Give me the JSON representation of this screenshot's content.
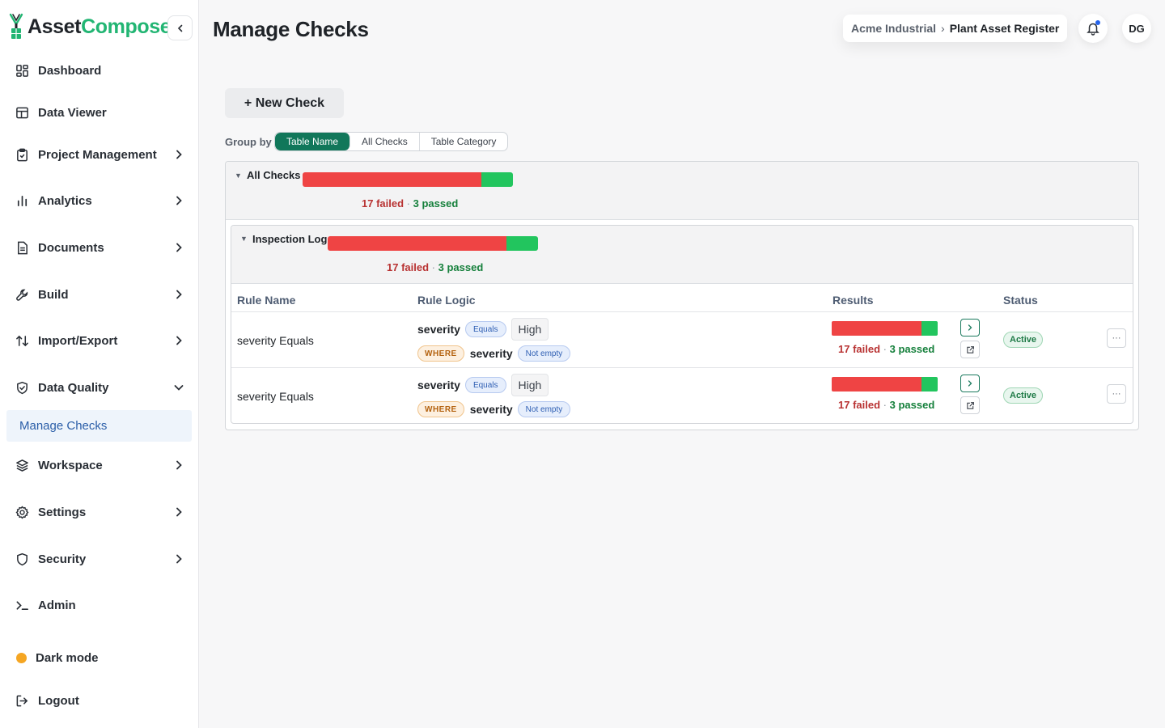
{
  "brand": {
    "part1": "Asset",
    "part2": "Compose"
  },
  "sidebar": {
    "items": [
      {
        "label": "Dashboard",
        "icon": "dashboard-icon"
      },
      {
        "label": "Data Viewer",
        "icon": "table-icon"
      },
      {
        "label": "Project Management",
        "icon": "clipboard-icon"
      },
      {
        "label": "Analytics",
        "icon": "bar-chart-icon"
      },
      {
        "label": "Documents",
        "icon": "document-icon"
      },
      {
        "label": "Build",
        "icon": "wrench-icon"
      },
      {
        "label": "Import/Export",
        "icon": "arrows-updown-icon"
      },
      {
        "label": "Data Quality",
        "icon": "shield-check-icon"
      },
      {
        "label": "Workspace",
        "icon": "layers-icon"
      },
      {
        "label": "Settings",
        "icon": "gear-icon"
      },
      {
        "label": "Security",
        "icon": "shield-icon"
      },
      {
        "label": "Admin",
        "icon": "terminal-icon"
      }
    ],
    "active_sub": "Manage Checks",
    "dark_mode_label": "Dark mode",
    "logout_label": "Logout"
  },
  "header": {
    "title": "Manage Checks",
    "breadcrumb": {
      "org": "Acme Industrial",
      "separator": "›",
      "register": "Plant Asset Register"
    },
    "avatar_initials": "DG"
  },
  "toolbar": {
    "new_check_label": "+ New Check",
    "group_by_label": "Group by",
    "group_options": [
      "Table Name",
      "All Checks",
      "Table Category"
    ],
    "group_selected": "Table Name"
  },
  "groups": {
    "outer": {
      "title": "All Checks",
      "failed": 17,
      "passed": 3,
      "failed_text": "17 failed",
      "sep": "·",
      "passed_text": "3 passed"
    },
    "inner": {
      "title": "Inspection Log",
      "failed": 17,
      "passed": 3,
      "failed_text": "17 failed",
      "sep": "·",
      "passed_text": "3 passed"
    }
  },
  "table": {
    "columns": [
      "Rule Name",
      "Rule Logic",
      "Results",
      "Status"
    ],
    "rows": [
      {
        "rule_name": "severity Equals",
        "field": "severity",
        "operator": "Equals",
        "value": "High",
        "where_label": "WHERE",
        "where_field": "severity",
        "where_condition": "Not empty",
        "failed": 17,
        "passed": 3,
        "failed_text": "17 failed",
        "sep": "·",
        "passed_text": "3 passed",
        "status": "Active",
        "more_label": "···"
      },
      {
        "rule_name": "severity Equals",
        "field": "severity",
        "operator": "Equals",
        "value": "High",
        "where_label": "WHERE",
        "where_field": "severity",
        "where_condition": "Not empty",
        "failed": 17,
        "passed": 3,
        "failed_text": "17 failed",
        "sep": "·",
        "passed_text": "3 passed",
        "status": "Active",
        "more_label": "···"
      }
    ]
  },
  "colors": {
    "failed": "#ef4444",
    "passed": "#22c55e",
    "accent": "#11775a",
    "brand_green": "#22b573"
  }
}
